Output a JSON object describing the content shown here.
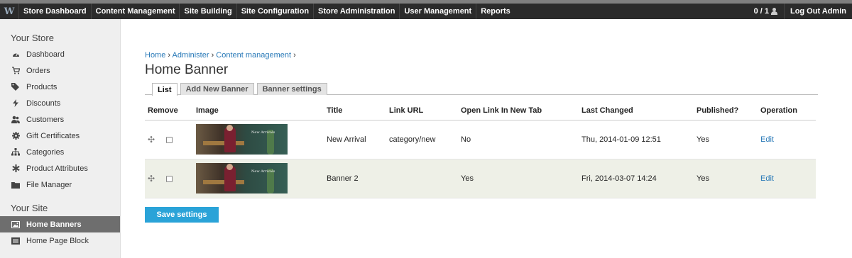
{
  "topbar": {
    "logo": "W",
    "nav": [
      "Store Dashboard",
      "Content Management",
      "Site Building",
      "Site Configuration",
      "Store Administration",
      "User Management",
      "Reports"
    ],
    "counter": "0 / 1",
    "logout": "Log Out Admin"
  },
  "sidebar": {
    "store_heading": "Your Store",
    "store_items": [
      {
        "label": "Dashboard",
        "icon": "dashboard-icon"
      },
      {
        "label": "Orders",
        "icon": "cart-icon"
      },
      {
        "label": "Products",
        "icon": "tags-icon"
      },
      {
        "label": "Discounts",
        "icon": "bolt-icon"
      },
      {
        "label": "Customers",
        "icon": "users-icon"
      },
      {
        "label": "Gift Certificates",
        "icon": "gear-icon"
      },
      {
        "label": "Categories",
        "icon": "sitemap-icon"
      },
      {
        "label": "Product Attributes",
        "icon": "asterisk-icon"
      },
      {
        "label": "File Manager",
        "icon": "folder-icon"
      }
    ],
    "site_heading": "Your Site",
    "site_items": [
      {
        "label": "Home Banners",
        "icon": "image-icon",
        "active": true
      },
      {
        "label": "Home Page Block",
        "icon": "list-icon",
        "active": false
      }
    ]
  },
  "main": {
    "breadcrumb": [
      "Home",
      "Administer",
      "Content management"
    ],
    "title": "Home Banner",
    "tabs": [
      {
        "label": "List",
        "active": true
      },
      {
        "label": "Add New Banner",
        "active": false
      },
      {
        "label": "Banner settings",
        "active": false
      }
    ],
    "columns": [
      "Remove",
      "Image",
      "Title",
      "Link URL",
      "Open Link In New Tab",
      "Last Changed",
      "Published?",
      "Operation"
    ],
    "rows": [
      {
        "title": "New Arrival",
        "link": "category/new",
        "new_tab": "No",
        "changed": "Thu, 2014-01-09 12:51",
        "published": "Yes",
        "operation": "Edit",
        "thumb_text": "New Arrivals"
      },
      {
        "title": "Banner 2",
        "link": "",
        "new_tab": "Yes",
        "changed": "Fri, 2014-03-07 14:24",
        "published": "Yes",
        "operation": "Edit",
        "thumb_text": "New Arrivals"
      }
    ],
    "save_label": "Save settings"
  },
  "colors": {
    "accent": "#2aa3d8",
    "link": "#2a7ab8",
    "topbar": "#2b2b2b",
    "active_sidebar": "#6e6e6e"
  }
}
